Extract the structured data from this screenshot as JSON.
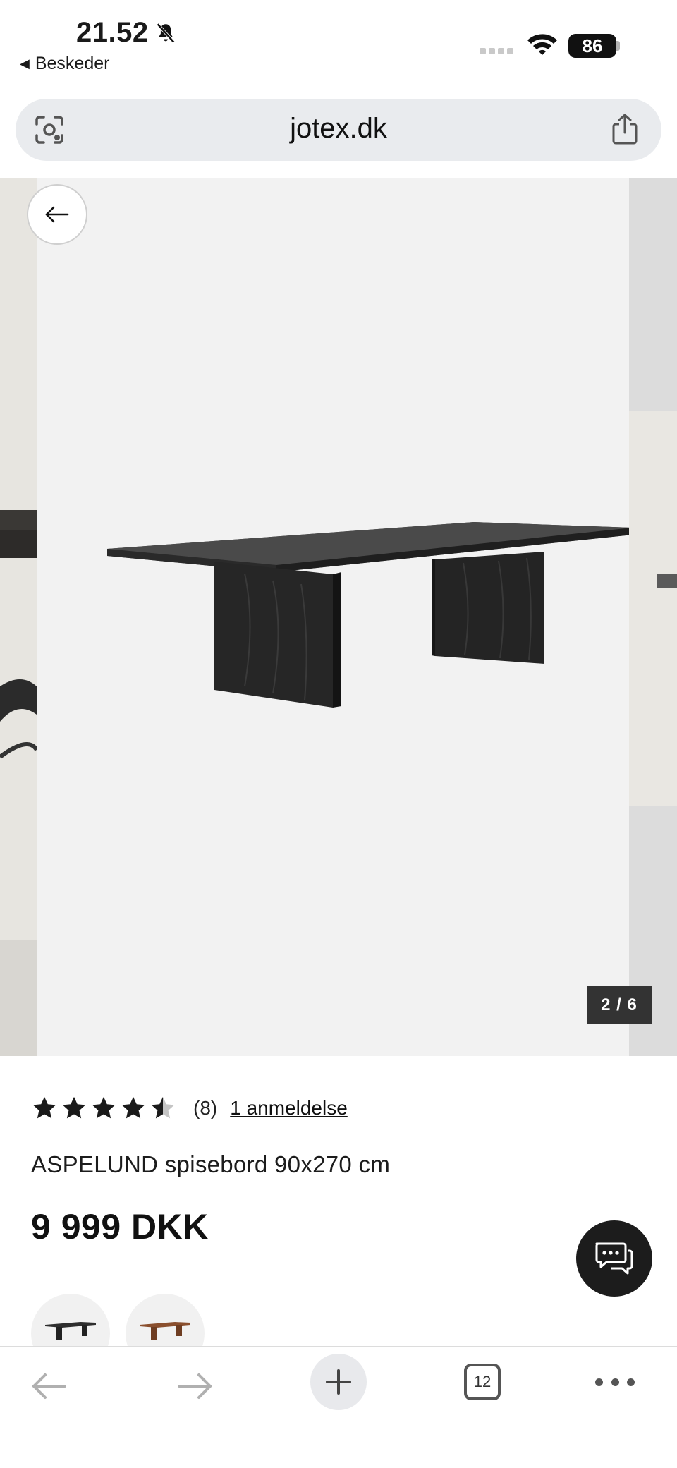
{
  "status_bar": {
    "time": "21.52",
    "back_app_label": "Beskeder",
    "battery": "86"
  },
  "browser": {
    "url": "jotex.dk"
  },
  "gallery": {
    "counter": "2 / 6"
  },
  "product": {
    "rating_value": 4.5,
    "rating_count": "(8)",
    "review_link": "1 anmeldelse",
    "name": "ASPELUND spisebord 90x270 cm",
    "price": "9 999 DKK",
    "swatches": [
      "black-table-swatch",
      "brown-table-swatch"
    ]
  },
  "toolbar": {
    "tab_count": "12"
  },
  "colors": {
    "accent": "#1c1c1c",
    "gallery_bg": "#f2f2f2",
    "url_bar_bg": "#e9ebee"
  }
}
